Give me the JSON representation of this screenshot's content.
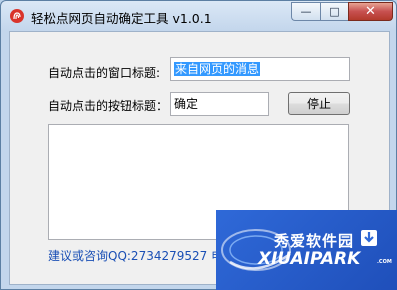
{
  "window": {
    "title": "轻松点网页自动确定工具 v1.0.1",
    "app_icon": "fingerprint-icon",
    "controls": {
      "minimize": "—",
      "maximize": "□",
      "close": "✕"
    }
  },
  "form": {
    "window_title_label": "自动点击的窗口标题:",
    "window_title_value": "来自网页的消息",
    "button_title_label": "自动点击的按钮标题：",
    "button_title_value": "确定",
    "stop_button": "停止"
  },
  "log": {
    "content": ""
  },
  "footer": {
    "contact": "建议或咨询QQ:2734279527 电"
  },
  "watermark": {
    "chinese": "秀爱软件园",
    "english": "XIUAIPARK",
    "suffix": ".COM",
    "icon": "download-arrow-icon"
  },
  "colors": {
    "link_text": "#1a4fb5",
    "selection": "#3399ff",
    "watermark_bg": "#2f69d8",
    "close_button": "#c75050"
  }
}
